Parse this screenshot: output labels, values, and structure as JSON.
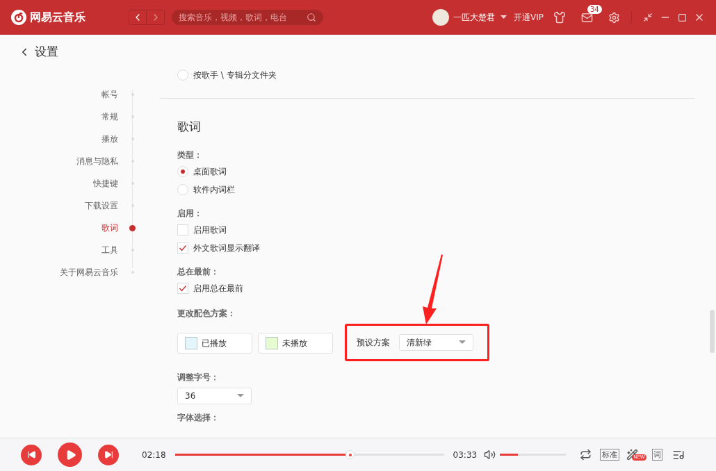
{
  "app": {
    "logo_text": "网易云音乐",
    "search_placeholder": "搜索音乐，视频，歌词，电台",
    "user_name": "一匹大楚君",
    "vip": "开通VIP",
    "mail_badge": "34"
  },
  "page": {
    "title": "设置"
  },
  "sidebar": {
    "items": [
      {
        "label": "帐号",
        "selected": false
      },
      {
        "label": "常规",
        "selected": false
      },
      {
        "label": "播放",
        "selected": false
      },
      {
        "label": "消息与隐私",
        "selected": false
      },
      {
        "label": "快捷键",
        "selected": false
      },
      {
        "label": "下载设置",
        "selected": false
      },
      {
        "label": "歌词",
        "selected": true
      },
      {
        "label": "工具",
        "selected": false
      },
      {
        "label": "关于网易云音乐",
        "selected": false
      }
    ]
  },
  "settings": {
    "prev_option": {
      "kind": "radio",
      "label": "按歌手 \\ 专辑分文件夹",
      "checked": false
    },
    "section_title": "歌词",
    "groups": [
      {
        "title": "类型：",
        "options": [
          {
            "kind": "radio",
            "label": "桌面歌词",
            "checked": true
          },
          {
            "kind": "radio",
            "label": "软件内词栏",
            "checked": false
          }
        ]
      },
      {
        "title": "启用：",
        "options": [
          {
            "kind": "checkbox",
            "label": "启用歌词",
            "checked": false
          },
          {
            "kind": "checkbox",
            "label": "外文歌词显示翻译",
            "checked": true
          }
        ]
      },
      {
        "title": "总在最前：",
        "options": [
          {
            "kind": "checkbox",
            "label": "启用总在最前",
            "checked": true
          }
        ]
      }
    ],
    "colors": {
      "title": "更改配色方案：",
      "swatches": [
        {
          "label": "已播放",
          "color": "#e4f6fb"
        },
        {
          "label": "未播放",
          "color": "#e6fbd0"
        }
      ],
      "preset_label": "预设方案",
      "preset_value": "清新绿"
    },
    "font_size": {
      "title": "调整字号：",
      "value": "36"
    },
    "font": {
      "title": "字体选择："
    }
  },
  "player": {
    "elapsed": "02:18",
    "total": "03:33",
    "progress": {
      "level": 0.65
    },
    "volume": {
      "level": 0.27
    },
    "quality": "标准",
    "new_badge": "NEW",
    "lyric_button": "词"
  }
}
